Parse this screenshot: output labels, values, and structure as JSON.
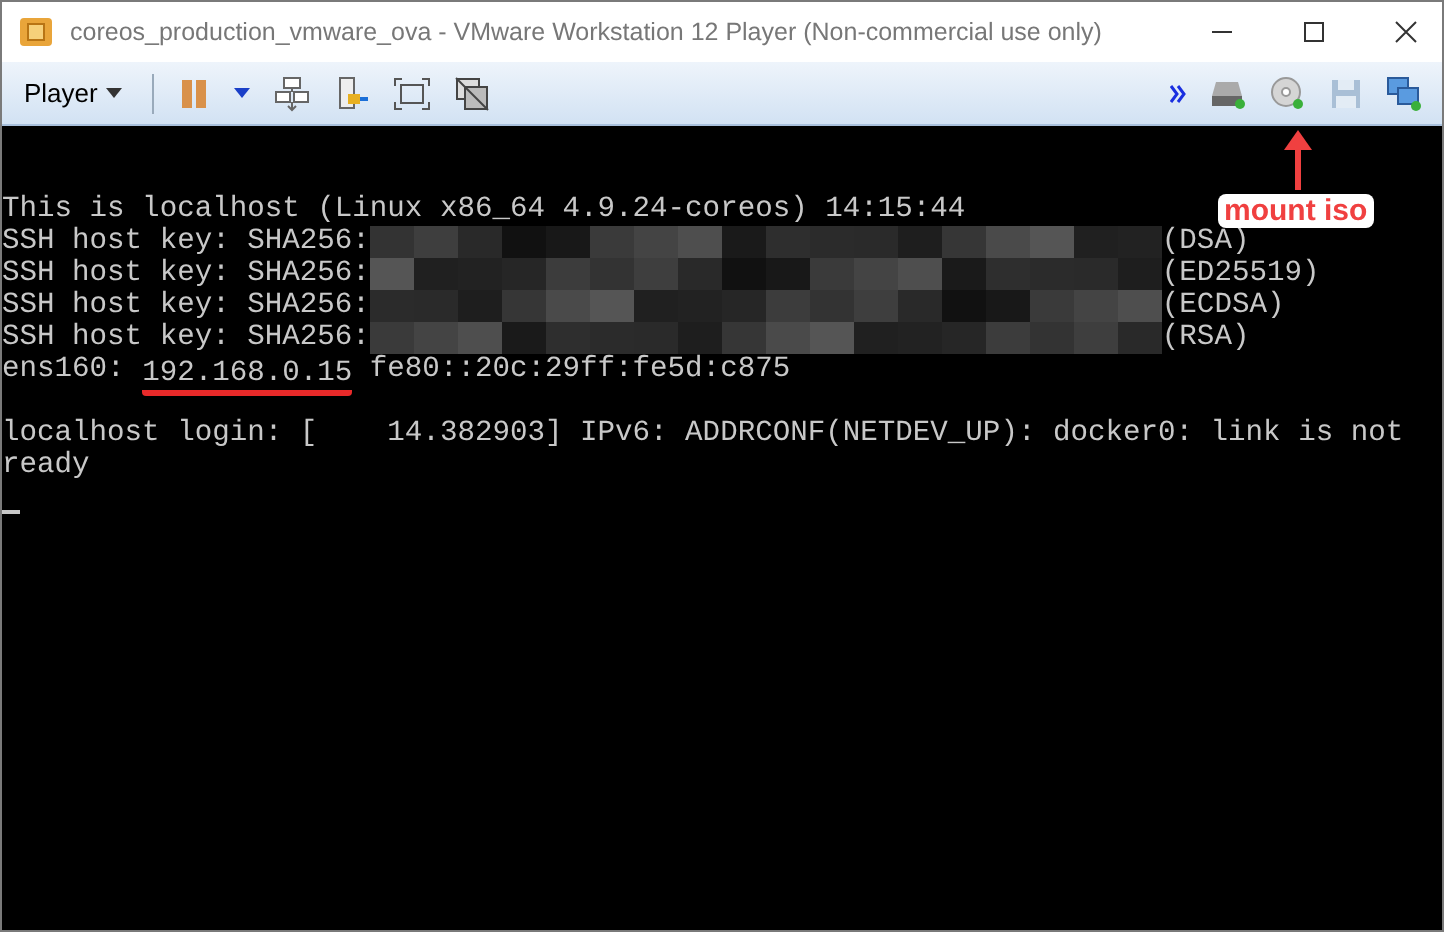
{
  "window": {
    "title": "coreos_production_vmware_ova - VMware Workstation 12 Player (Non-commercial use only)"
  },
  "toolbar": {
    "player_menu": "Player"
  },
  "console": {
    "lines": [
      {
        "kind": "text",
        "text": "This is localhost (Linux x86_64 4.9.24-coreos) 14:15:44",
        "gap_before": false
      },
      {
        "kind": "key",
        "prefix": "SSH host key: SHA256:",
        "suffix": "(DSA)",
        "gap_before": false
      },
      {
        "kind": "key",
        "prefix": "SSH host key: SHA256:",
        "suffix": "(ED25519)",
        "gap_before": false
      },
      {
        "kind": "key",
        "prefix": "SSH host key: SHA256:",
        "suffix": "(ECDSA)",
        "gap_before": false
      },
      {
        "kind": "key",
        "prefix": "SSH host key: SHA256:",
        "suffix": "(RSA)",
        "gap_before": false
      },
      {
        "kind": "ip",
        "prefix": "ens160: ",
        "address": "192.168.0.15",
        "rest": " fe80::20c:29ff:fe5d:c875",
        "underlined": true,
        "gap_before": false
      },
      {
        "kind": "text",
        "text": "localhost login: [    14.382903] IPv6: ADDRCONF(NETDEV_UP): docker0: link is not",
        "gap_before": true
      },
      {
        "kind": "text",
        "text": "ready",
        "gap_before": false
      },
      {
        "kind": "cursor",
        "gap_before": false
      }
    ]
  },
  "callout": {
    "label": "mount iso"
  }
}
